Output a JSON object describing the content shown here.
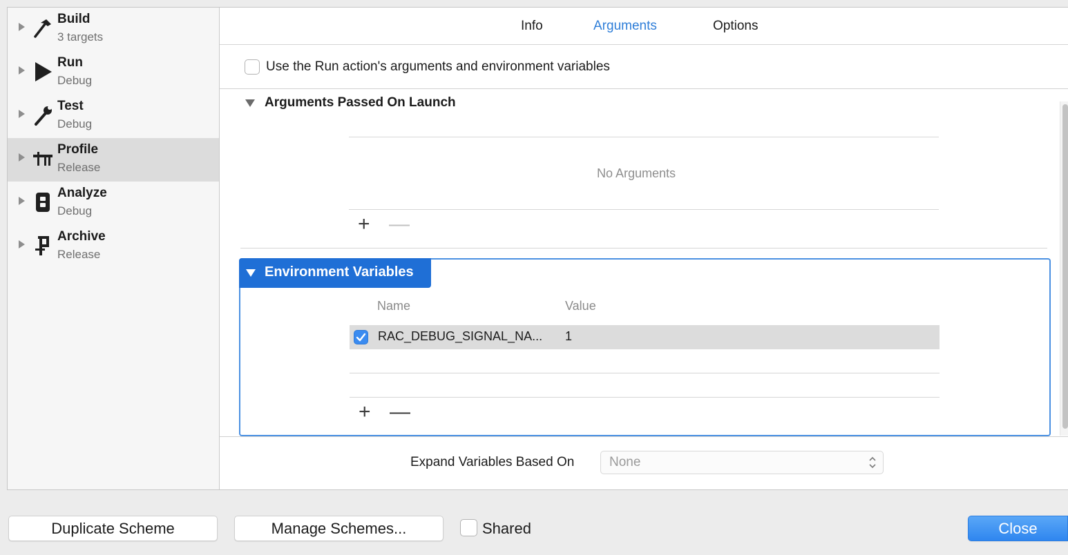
{
  "sidebar": {
    "items": [
      {
        "title": "Build",
        "subtitle": "3 targets",
        "icon": "hammer-icon"
      },
      {
        "title": "Run",
        "subtitle": "Debug",
        "icon": "play-icon"
      },
      {
        "title": "Test",
        "subtitle": "Debug",
        "icon": "wrench-icon"
      },
      {
        "title": "Profile",
        "subtitle": "Release",
        "icon": "instruments-icon"
      },
      {
        "title": "Analyze",
        "subtitle": "Debug",
        "icon": "analyze-icon"
      },
      {
        "title": "Archive",
        "subtitle": "Release",
        "icon": "archive-icon"
      }
    ],
    "selected_index": 3
  },
  "tabs": [
    {
      "label": "Info",
      "active": false
    },
    {
      "label": "Arguments",
      "active": true
    },
    {
      "label": "Options",
      "active": false
    }
  ],
  "use_run_action": {
    "label": "Use the Run action's arguments and environment variables",
    "checked": false
  },
  "arguments_section": {
    "title": "Arguments Passed On Launch",
    "empty_text": "No Arguments",
    "add_label": "+",
    "remove_label": "—"
  },
  "environment_section": {
    "title": "Environment Variables",
    "columns": {
      "name": "Name",
      "value": "Value"
    },
    "rows": [
      {
        "enabled": true,
        "name": "RAC_DEBUG_SIGNAL_NA...",
        "value": "1"
      }
    ],
    "add_label": "+",
    "remove_label": "—"
  },
  "expand_variables": {
    "label": "Expand Variables Based On",
    "value": "None"
  },
  "footer": {
    "duplicate_label": "Duplicate Scheme",
    "manage_label": "Manage Schemes...",
    "shared_label": "Shared",
    "shared_checked": false,
    "close_label": "Close"
  },
  "colors": {
    "accent": "#2f7ed8",
    "env_header": "#1f6fd6",
    "selected_row": "#dcdcdc"
  }
}
